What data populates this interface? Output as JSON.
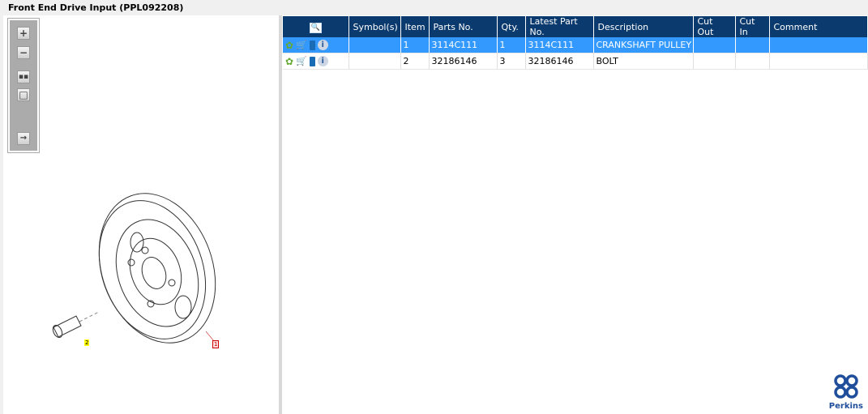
{
  "title": "Front End Drive Input (PPL092208)",
  "toolbar": {
    "items": [
      "zoom-in",
      "zoom-out",
      "fit-all",
      "fit-window",
      "export"
    ]
  },
  "drawing": {
    "callouts": [
      "2",
      "1"
    ]
  },
  "table": {
    "headers": [
      "",
      "Symbol(s)",
      "Item",
      "Parts No.",
      "Qty.",
      "Latest Part No.",
      "Description",
      "Cut Out",
      "Cut In",
      "Comment"
    ],
    "rows": [
      {
        "symbols": "",
        "item": "1",
        "parts_no": "3114C111",
        "qty": "1",
        "latest": "3114C111",
        "description": "CRANKSHAFT PULLEY",
        "cut_out": "",
        "cut_in": "",
        "comment": "",
        "selected": true
      },
      {
        "symbols": "",
        "item": "2",
        "parts_no": "32186146",
        "qty": "3",
        "latest": "32186146",
        "description": "BOLT",
        "cut_out": "",
        "cut_in": "",
        "comment": "",
        "selected": false
      }
    ]
  },
  "logo": "Perkins",
  "colors": {
    "header": "#0b3a6e",
    "selected": "#3399ff",
    "brand": "#1f4e9b"
  }
}
